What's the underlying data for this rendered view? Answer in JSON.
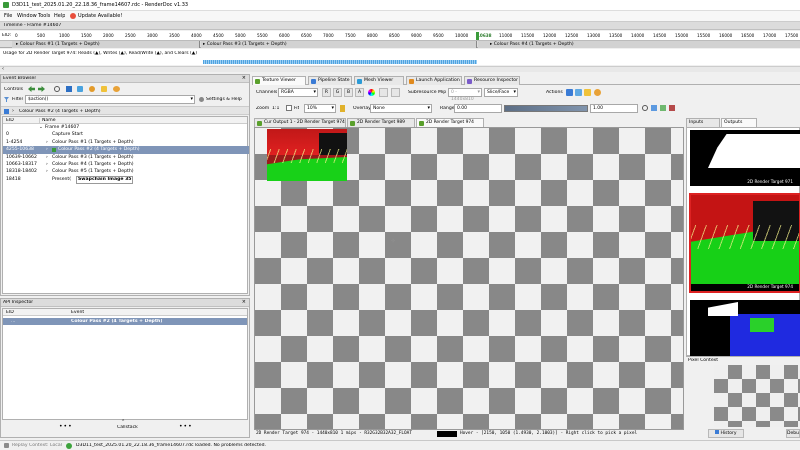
{
  "window": {
    "title": "D3D11_test_2025.01.20_22.18.36_frame14607.rdc - RenderDoc v1.33"
  },
  "menu": {
    "file": "File",
    "window": "Window",
    "tools": "Tools",
    "help": "Help",
    "update": "Update Available!"
  },
  "timeline": {
    "header": "Timeline - Frame #14607",
    "eid_label": "EID:",
    "ticks": [
      "0",
      "500",
      "1000",
      "1500",
      "2000",
      "2500",
      "3000",
      "3500",
      "4000",
      "4500",
      "5000",
      "5500",
      "6000",
      "6500",
      "7000",
      "7500",
      "8000",
      "8500",
      "9000",
      "9500",
      "10000",
      "10638",
      "11000",
      "11500",
      "12000",
      "12500",
      "13000",
      "13500",
      "14000",
      "14500",
      "15000",
      "15500",
      "16000",
      "16500",
      "17000",
      "17500"
    ],
    "passes": [
      "Colour Pass #1 (1 Targets + Depth)",
      "Colour Pass #3 (1 Targets + Depth)",
      "Colour Pass #4 (1 Targets + Depth)"
    ],
    "usage_text": "Usage for 2D Render Target 974: Reads (▲), Writes (▲), Read/Write (▲), and Clears (▲)"
  },
  "event_browser": {
    "title": "Event Browser",
    "controls_label": "Controls",
    "filter_label": "Filter",
    "filter_value": "$action()",
    "settings_label": "Settings & Help",
    "current_pass": "Colour Pass #2 (4 Targets + Depth)",
    "col_eid": "EID",
    "col_name": "Name",
    "rows": [
      {
        "eid": "",
        "name": "Frame #14607",
        "indent": 0,
        "arrow": "v"
      },
      {
        "eid": "0",
        "name": "Capture Start",
        "indent": 1,
        "arrow": ""
      },
      {
        "eid": "1-4254",
        "name": "Colour Pass #1 (1 Targets + Depth)",
        "indent": 1,
        "arrow": ">"
      },
      {
        "eid": "4255-10638",
        "name": "Colour Pass #2 (4 Targets + Depth)",
        "indent": 1,
        "arrow": ">",
        "selected": true
      },
      {
        "eid": "10639-10662",
        "name": "Colour Pass #3 (1 Targets + Depth)",
        "indent": 1,
        "arrow": ">"
      },
      {
        "eid": "10663-18317",
        "name": "Colour Pass #4 (1 Targets + Depth)",
        "indent": 1,
        "arrow": ">"
      },
      {
        "eid": "18318-18402",
        "name": "Colour Pass #5 (1 Targets + Depth)",
        "indent": 1,
        "arrow": ">"
      },
      {
        "eid": "18418",
        "name": "Present(",
        "bold_part": "Swapchain Image 35",
        "indent": 1,
        "arrow": ""
      }
    ]
  },
  "api_inspector": {
    "title": "API Inspector",
    "col_eid": "EID",
    "col_event": "Event",
    "row_eid": "...",
    "row_event": "Colour Pass #2 (4 Targets + Depth)",
    "callstack": "Callstack"
  },
  "tabs": [
    {
      "label": "Texture Viewer",
      "color": "#5aa02c"
    },
    {
      "label": "Pipeline State",
      "color": "#3a7bd5"
    },
    {
      "label": "Mesh Viewer",
      "color": "#2b9ad6"
    },
    {
      "label": "Launch Application",
      "color": "#e08a1e"
    },
    {
      "label": "Resource Inspector",
      "color": "#7a5bc9"
    }
  ],
  "texture_toolbar": {
    "channels_label": "Channels",
    "channels_value": "RGBA",
    "r": "R",
    "g": "G",
    "b": "B",
    "a": "A",
    "subresource_label": "Subresource",
    "mip_label": "Mip",
    "mip_value": "0 - 1440x810",
    "slice_value": "Slice/Face",
    "actions_label": "Actions",
    "zoom_label": "Zoom",
    "zoom_ratio": "1:1",
    "fit_label": "Fit",
    "zoom_value": "10%",
    "overlay_label": "Overlay",
    "overlay_value": "None",
    "range_label": "Range",
    "range_min": "0.00",
    "range_max": "1.00"
  },
  "texture_tabs": [
    {
      "label": "Cur Output 1 - 2D Render Target 974"
    },
    {
      "label": "2D Render Target 989"
    },
    {
      "label": "2D Render Target 974"
    }
  ],
  "status_line": "2D Render Target 974 - 1440x810 1 mips - R32G32B32A32_FLOAT",
  "status_hover": "Hover - [2150, 1050 (1.4930, 2.1003)] - Right click to pick a pixel",
  "thumbs": {
    "inputs_tab": "Inputs",
    "outputs_tab": "Outputs",
    "label_1": "2D Render Target 971",
    "label_2": "2D Render Target 974",
    "pixel_context": "Pixel Context",
    "history": "History",
    "debug": "Debu"
  },
  "statusbar": {
    "replay": "Replay Context: Local",
    "message": "D3D11_test_2025.01.20_22.18.36_frame14607.rdc loaded. No problems detected."
  }
}
